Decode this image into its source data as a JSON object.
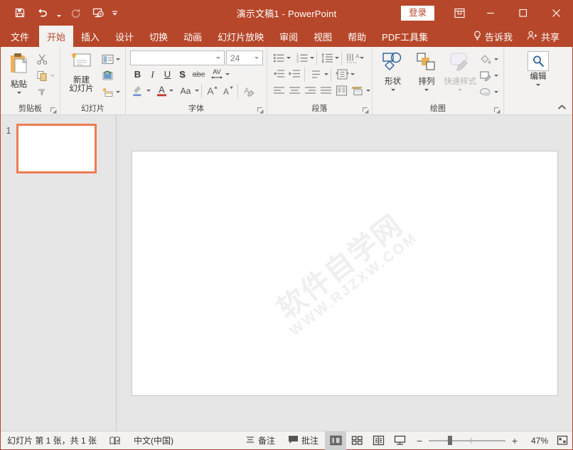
{
  "titlebar": {
    "quick_access": [
      {
        "name": "save-icon",
        "label": "保存"
      },
      {
        "name": "undo-icon",
        "label": "撤消"
      },
      {
        "name": "redo-icon",
        "label": "恢复"
      },
      {
        "name": "start-slideshow-icon",
        "label": "从头开始"
      },
      {
        "name": "customize-qat-icon",
        "label": "自定义快速访问工具栏"
      }
    ],
    "title": "演示文稿1  -  PowerPoint",
    "signin_label": "登录",
    "ribbon_display_options": "功能区显示选项",
    "minimize": "最小化",
    "maximize": "最大化",
    "close": "关闭"
  },
  "tabs": [
    {
      "label": "文件",
      "active": false
    },
    {
      "label": "开始",
      "active": true
    },
    {
      "label": "插入",
      "active": false
    },
    {
      "label": "设计",
      "active": false
    },
    {
      "label": "切换",
      "active": false
    },
    {
      "label": "动画",
      "active": false
    },
    {
      "label": "幻灯片放映",
      "active": false
    },
    {
      "label": "审阅",
      "active": false
    },
    {
      "label": "视图",
      "active": false
    },
    {
      "label": "帮助",
      "active": false
    },
    {
      "label": "PDF工具集",
      "active": false
    }
  ],
  "tab_right": {
    "tell_me": "告诉我",
    "share": "共享"
  },
  "ribbon": {
    "clipboard": {
      "label": "剪贴板",
      "paste": "粘贴",
      "cut": "剪切",
      "copy": "复制",
      "format_painter": "格式刷"
    },
    "slides": {
      "label": "幻灯片",
      "new_slide": "新建\n幻灯片",
      "new_slide_line1": "新建",
      "new_slide_line2": "幻灯片",
      "layout": "版式",
      "reset": "重置",
      "section": "节"
    },
    "font": {
      "label": "字体",
      "font_name_value": "",
      "font_name_placeholder": "",
      "font_size_value": "24",
      "bold": "B",
      "italic": "I",
      "underline": "U",
      "shadow": "S",
      "strikethrough": "abc",
      "char_spacing": "AV",
      "text_highlight": "文本突出显示颜色",
      "font_color": "A",
      "change_case": "Aa",
      "increase_size": "A",
      "decrease_size": "A",
      "clear_formatting": "清除所有格式"
    },
    "paragraph": {
      "label": "段落",
      "bullets": "项目符号",
      "numbering": "编号",
      "decrease_indent": "减少缩进量",
      "increase_indent": "增加缩进量",
      "line_spacing": "行距",
      "text_direction": "文字方向",
      "align_text": "对齐文本",
      "align_left": "左对齐",
      "align_center": "居中",
      "align_right": "右对齐",
      "justify": "两端对齐",
      "columns": "分栏",
      "smartart": "转换为 SmartArt"
    },
    "drawing": {
      "label": "绘图",
      "shapes": "形状",
      "arrange": "排列",
      "quick_styles": "快速样式",
      "shape_fill": "形状填充",
      "shape_outline": "形状轮廓",
      "shape_effects": "形状效果"
    },
    "editing": {
      "label": "编辑",
      "editing_btn": "编辑"
    },
    "collapse_ribbon": "折叠功能区"
  },
  "thumbnails": {
    "slides": [
      {
        "number": "1",
        "selected": true
      }
    ]
  },
  "slide": {
    "watermark_line1": "软件自学网",
    "watermark_line2": "WWW.RJZXW.COM"
  },
  "status": {
    "slide_count": "幻灯片 第 1 张，共 1 张",
    "proofing_icon": "spellcheck-icon",
    "language": "中文(中国)",
    "notes": "备注",
    "comments": "批注",
    "views": [
      {
        "name": "normal-view",
        "label": "普通视图",
        "active": true
      },
      {
        "name": "slide-sorter-view",
        "label": "幻灯片浏览",
        "active": false
      },
      {
        "name": "reading-view",
        "label": "阅读视图",
        "active": false
      },
      {
        "name": "slideshow-view",
        "label": "幻灯片放映",
        "active": false
      }
    ],
    "zoom_out": "−",
    "zoom_in": "+",
    "zoom_value": "47%",
    "fit_window": "使幻灯片适应当前窗口"
  },
  "colors": {
    "brand": "#b7472a",
    "ribbon_bg": "#f3f2f1",
    "workspace": "#e6e6e6",
    "thumb_selected": "#ed7d50"
  }
}
